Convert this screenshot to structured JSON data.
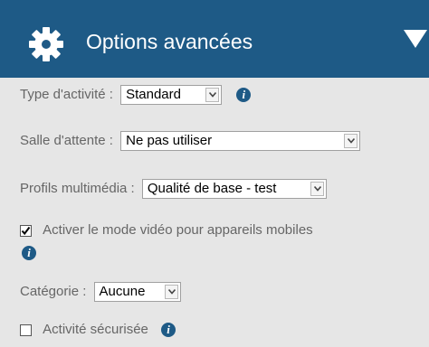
{
  "header": {
    "title": "Options avancées",
    "icon": "gear-icon",
    "collapse_icon": "triangle-down-icon",
    "background": "#1e5a86"
  },
  "activity_type": {
    "label": "Type d'activité :",
    "value": "Standard"
  },
  "waiting_room": {
    "label": "Salle d'attente :",
    "value": "Ne pas utiliser"
  },
  "multimedia_profiles": {
    "label": "Profils multimédia :",
    "value": "Qualité de base - test"
  },
  "mobile_video": {
    "label": "Activer le mode vidéo pour appareils mobiles",
    "checked": true
  },
  "category": {
    "label": "Catégorie :",
    "value": "Aucune"
  },
  "secure_activity": {
    "label": "Activité sécurisée",
    "checked": false
  },
  "info_glyph": "i"
}
